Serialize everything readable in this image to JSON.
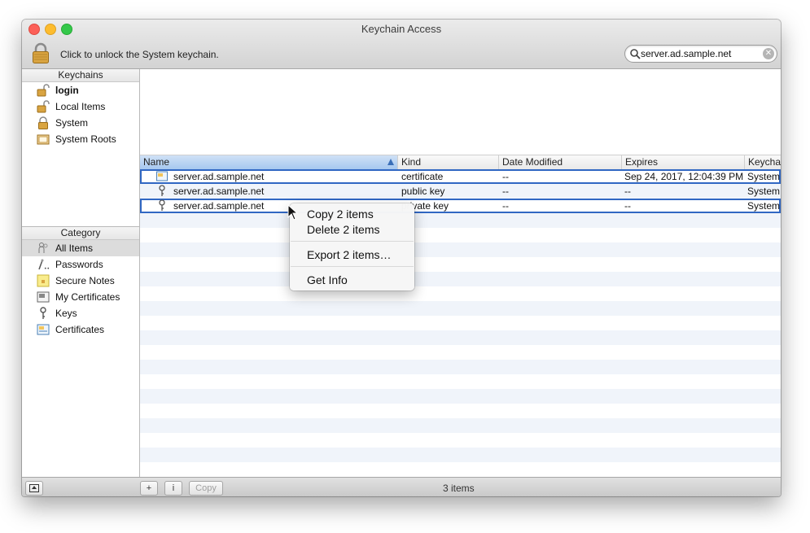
{
  "window": {
    "title": "Keychain Access"
  },
  "toolbar": {
    "lock_message": "Click to unlock the System keychain."
  },
  "search": {
    "value": "server.ad.sample.net"
  },
  "sidebar": {
    "keychains_header": "Keychains",
    "keychains": [
      {
        "label": "login",
        "icon": "lock-open-icon",
        "bold": true
      },
      {
        "label": "Local Items",
        "icon": "lock-open-icon"
      },
      {
        "label": "System",
        "icon": "lock-closed-icon"
      },
      {
        "label": "System Roots",
        "icon": "cabinet-icon"
      }
    ],
    "category_header": "Category",
    "categories": [
      {
        "label": "All Items",
        "icon": "people-icon",
        "selected": true
      },
      {
        "label": "Passwords",
        "icon": "key-pen-icon"
      },
      {
        "label": "Secure Notes",
        "icon": "note-icon"
      },
      {
        "label": "My Certificates",
        "icon": "certificate-icon"
      },
      {
        "label": "Keys",
        "icon": "key-icon"
      },
      {
        "label": "Certificates",
        "icon": "certificate-icon"
      }
    ]
  },
  "table": {
    "columns": [
      "Name",
      "Kind",
      "Date Modified",
      "Expires",
      "Keychain"
    ],
    "rows": [
      {
        "name": "server.ad.sample.net",
        "kind": "certificate",
        "date_modified": "--",
        "expires": "Sep 24, 2017, 12:04:39 PM",
        "keychain": "System",
        "icon": "certificate-icon",
        "selected": true
      },
      {
        "name": "server.ad.sample.net",
        "kind": "public key",
        "date_modified": "--",
        "expires": "--",
        "keychain": "System",
        "icon": "key-icon",
        "selected": false
      },
      {
        "name": "server.ad.sample.net",
        "kind": "private key",
        "date_modified": "--",
        "expires": "--",
        "keychain": "System",
        "icon": "key-icon",
        "selected": true
      }
    ]
  },
  "context_menu": {
    "items": [
      "Copy 2 items",
      "Delete 2 items",
      "Export 2 items…",
      "Get Info"
    ]
  },
  "statusbar": {
    "add": "+",
    "info": "i",
    "copy": "Copy",
    "count": "3 items"
  }
}
